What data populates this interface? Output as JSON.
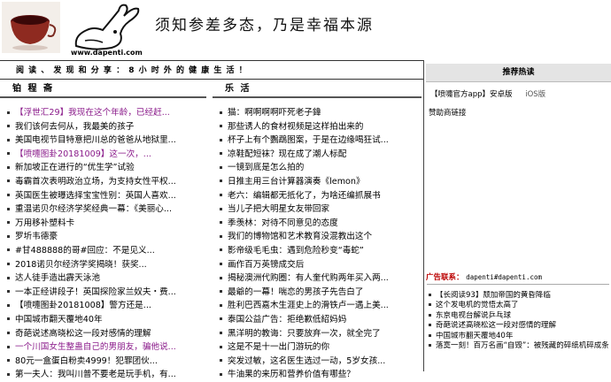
{
  "header": {
    "site_url": "www.dapenti.com",
    "slogan": "须知参差多态，乃是幸福本源"
  },
  "topbar": {
    "text": "阅 读 、 发 现 和 分 享 ： 8 小 时 外 的 健 康 生 活 ！"
  },
  "left_col": {
    "title": "铂 程 斋",
    "items": [
      {
        "text": "【浮世汇29】我现在这个年龄，已经赶...",
        "purple": true
      },
      {
        "text": "我们该何去何从，我最美的孩子",
        "purple": false
      },
      {
        "text": "美国电视节目特意把川总的爸爸从地狱里...",
        "purple": false
      },
      {
        "text": "【喷嚏图卦20181009】这一次，...",
        "purple": true
      },
      {
        "text": "新加坡正在进行的“优生学”试验",
        "purple": false
      },
      {
        "text": "毒霸首次表明政治立场，为支持女性平权...",
        "purple": false
      },
      {
        "text": "英国医生被曝选择宝宝性别：英国人喜欢...",
        "purple": false
      },
      {
        "text": "重温诺贝尔经济学奖经典一幕：《美丽心...",
        "purple": false
      },
      {
        "text": "万用移补塑料卡",
        "purple": false
      },
      {
        "text": "罗圻韦德豪",
        "purple": false
      },
      {
        "text": "#甘488888的哥#回应：不是见义...",
        "purple": false
      },
      {
        "text": "2018诺贝尔经济学奖揭晓！获奖...",
        "purple": false
      },
      {
        "text": "达人徒手造出霹天泳池",
        "purple": false
      },
      {
        "text": "一本正经讲段子！英国探险家兰奴夫・费...",
        "purple": false
      },
      {
        "text": "【喷嚏图卦20181008】警方还是...",
        "purple": false
      },
      {
        "text": "中国城市翻天覆地40年",
        "purple": false
      },
      {
        "text": "奇葩说述高晓松这一段对感情的理解",
        "purple": false
      },
      {
        "text": "一个川国女生整蛊自己的男朋友，骗他说...",
        "purple": true
      },
      {
        "text": "80元一盒蛋白粉卖4999！犯罪团伙...",
        "purple": false
      },
      {
        "text": "第一夫人：我叫川普不要老是玩手机，有...",
        "purple": false
      }
    ]
  },
  "right_col": {
    "title": "乐 活",
    "items": [
      "猫：啊啊啊啊吓死老子鍏",
      "那些诱人的食材视频是这样拍出来的",
      "杯子上有个鸚鵡图案，于是在边缘喝狂试...",
      "凉鞋配短袜？现在成了潮人标配",
      "一镜到底是怎么拍的",
      "日推主用三台计算器演奏《lemon》",
      "老六：编辑都无抵化了，为啥还编抓展书",
      "当儿子把大明星女友带回家",
      "季羡林：对待不同意见的态度",
      "我们的博物馆和艺术教育没混教出这个",
      "影帝级毛毛虫：遇到危险秒变“毒蛇”",
      "画作百万英镑成交后",
      "揭秘澳洲代购圈：有人奎代购两年买入两...",
      "最爺的一幕！喘恋的男孩子先告白了",
      "胜利巴西嘉木生涯史上的滑铁卢一遇上美...",
      "泰国公益广告：拒绝歉低紹妈妈",
      "黑洋明的教诲：只要放弃一次，就全完了",
      "这是不是十一出门游玩的你",
      "突发过敏，这名医生选过一动，5岁女孩...",
      "牛油果的来历和营养价值有哪些？"
    ]
  },
  "sidebar": {
    "hot_title": "推荐热读",
    "app_label": "【喷嚏官方app】安卓版",
    "ios_label": "iOS版",
    "sponsor_label": "赞助商链接",
    "contact_label": "广告联系：",
    "contact_email": "dapenti#dapenti.com",
    "links": [
      "【长阅读93】颓加帝国的黄昏降临",
      "这个发电机的觉悟太高了",
      "东京电视台解说乒乓球",
      "奇葩说述高晓松这一段对感情的理解",
      "中国城市翻天覆地40年",
      "落寞一刻！百万名画“自毁”：被残藏的碎纸机碎成条"
    ]
  },
  "colors": {
    "purple_link": "#8a1a8a",
    "contact_red": "#bb0000"
  }
}
